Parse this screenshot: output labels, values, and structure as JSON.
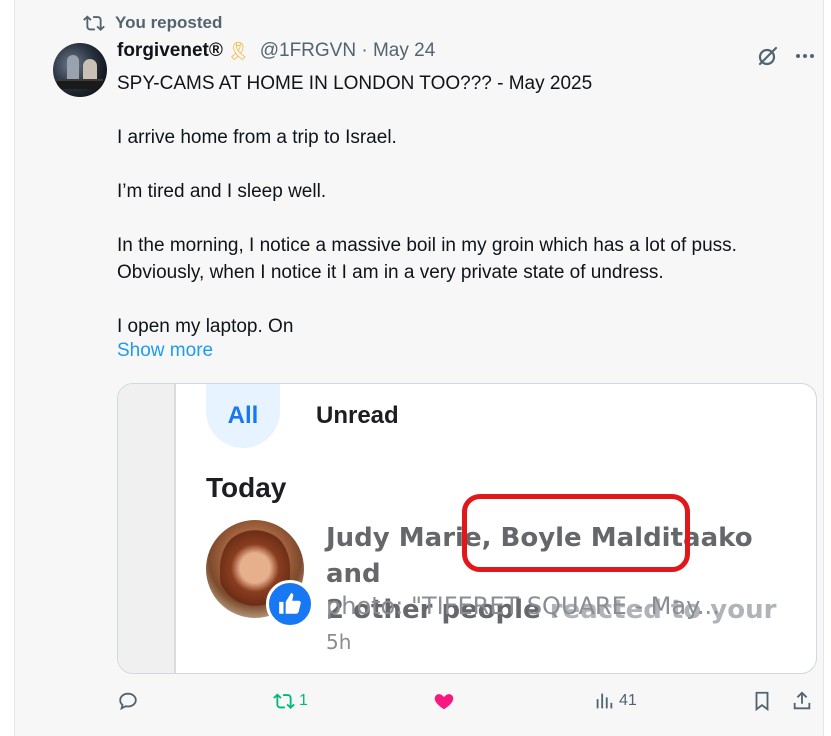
{
  "repost_label": "You reposted",
  "author": {
    "name": "forgivenet®",
    "ribbon": "🎗",
    "handle_date": "@1FRGVN · May 24"
  },
  "tweet": {
    "title": "SPY-CAMS AT HOME IN LONDON TOO??? - May 2025",
    "p1": "I arrive home from a trip to Israel.",
    "p2": "I’m tired and I sleep well.",
    "p3a": "In the morning, I notice a massive boil in my groin which has a lot of puss.",
    "p3b": "Obviously, when I notice it I am in a very private state of undress.",
    "p4": "I open my laptop. On",
    "show_more": "Show more"
  },
  "media": {
    "tab_all": "All",
    "tab_unread": "Unread",
    "section": "Today",
    "notif_line1_a": "Judy Marie, ",
    "notif_line1_b": "Boyle Malditaako",
    "notif_line1_c": " and",
    "notif_line2_a": "2 other people",
    "notif_line2_b": " reacted to your",
    "notif_line3": "photo: \"TIFERET SQUARE - May...",
    "notif_time": "5h"
  },
  "actions": {
    "reposts": "1",
    "views": "41"
  },
  "colors": {
    "accent": "#1d9bf0",
    "repost_green": "#00ba7c",
    "like_pink": "#f91880",
    "fb_blue": "#1877f2",
    "highlight_red": "#e0181c"
  }
}
